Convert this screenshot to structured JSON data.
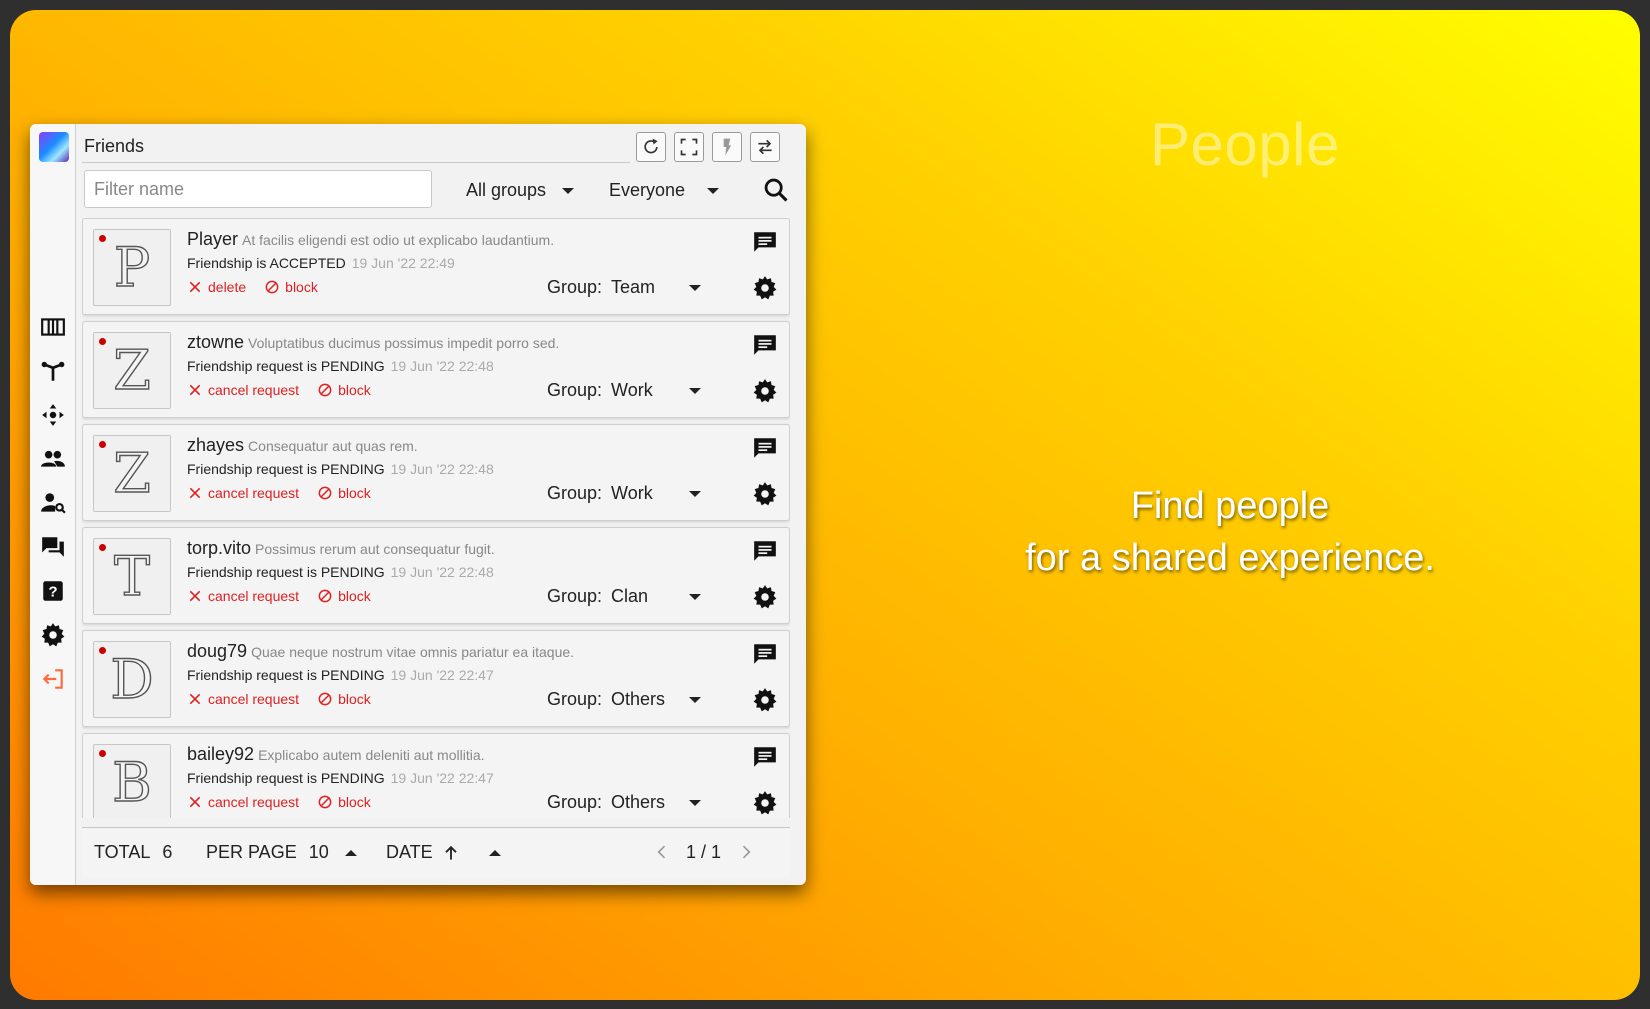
{
  "page": {
    "title": "People",
    "tagline_line1": "Find people",
    "tagline_line2": "for a shared experience."
  },
  "window": {
    "title": "Friends",
    "toolbar_icons": [
      "refresh-icon",
      "fullscreen-icon",
      "flash-icon",
      "swap-icon"
    ]
  },
  "sidebar": {
    "icons": [
      "columns-icon",
      "tree-icon",
      "move-icon",
      "people-icon",
      "user-search-icon",
      "chat-icon",
      "help-icon",
      "gear-icon",
      "logout-icon"
    ]
  },
  "filter": {
    "placeholder": "Filter name",
    "value": "",
    "group_select": "All groups",
    "scope_select": "Everyone"
  },
  "friends": [
    {
      "name": "Player",
      "motto": "At facilis eligendi est odio ut explicabo laudantium.",
      "status": "Friendship is ACCEPTED",
      "date": "19 Jun '22 22:49",
      "primary_action": "delete",
      "block_action": "block",
      "group_label": "Group:",
      "group": "Team",
      "letter": "P"
    },
    {
      "name": "ztowne",
      "motto": "Voluptatibus ducimus possimus impedit porro sed.",
      "status": "Friendship request is PENDING",
      "date": "19 Jun '22 22:48",
      "primary_action": "cancel request",
      "block_action": "block",
      "group_label": "Group:",
      "group": "Work",
      "letter": "Z"
    },
    {
      "name": "zhayes",
      "motto": "Consequatur aut quas rem.",
      "status": "Friendship request is PENDING",
      "date": "19 Jun '22 22:48",
      "primary_action": "cancel request",
      "block_action": "block",
      "group_label": "Group:",
      "group": "Work",
      "letter": "Z"
    },
    {
      "name": "torp.vito",
      "motto": "Possimus rerum aut consequatur fugit.",
      "status": "Friendship request is PENDING",
      "date": "19 Jun '22 22:48",
      "primary_action": "cancel request",
      "block_action": "block",
      "group_label": "Group:",
      "group": "Clan",
      "letter": "T"
    },
    {
      "name": "doug79",
      "motto": "Quae neque nostrum vitae omnis pariatur ea itaque.",
      "status": "Friendship request is PENDING",
      "date": "19 Jun '22 22:47",
      "primary_action": "cancel request",
      "block_action": "block",
      "group_label": "Group:",
      "group": "Others",
      "letter": "D"
    },
    {
      "name": "bailey92",
      "motto": "Explicabo autem deleniti aut mollitia.",
      "status": "Friendship request is PENDING",
      "date": "19 Jun '22 22:47",
      "primary_action": "cancel request",
      "block_action": "block",
      "group_label": "Group:",
      "group": "Others",
      "letter": "B"
    }
  ],
  "footer": {
    "total_label": "TOTAL",
    "total_value": "6",
    "per_page_label": "PER PAGE",
    "per_page_value": "10",
    "sort_label": "DATE",
    "pagination": "1 / 1"
  },
  "colors": {
    "accent_red": "#e02020",
    "gradient_top": "#ffff00",
    "gradient_bottom": "#ff7a00"
  }
}
